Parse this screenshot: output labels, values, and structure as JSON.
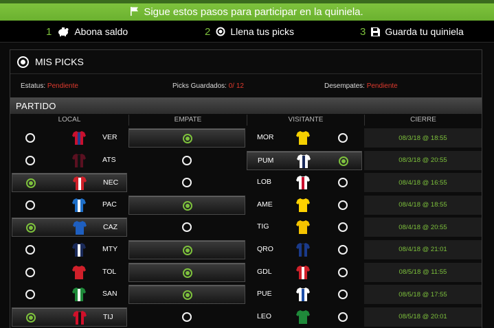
{
  "banner": {
    "text": "Sigue estos pasos para participar en la quiniela."
  },
  "steps": [
    {
      "num": "1",
      "label": "Abona saldo",
      "icon": "piggy-bank-icon"
    },
    {
      "num": "2",
      "label": "Llena tus picks",
      "icon": "radio-target-icon"
    },
    {
      "num": "3",
      "label": "Guarda tu quiniela",
      "icon": "floppy-disk-icon"
    }
  ],
  "panel": {
    "title": "MIS PICKS",
    "estatus_label": "Estatus:",
    "estatus_value": "Pendiente",
    "guardados_label": "Picks Guardados:",
    "guardados_value": "0/ 12",
    "desempates_label": "Desempates:",
    "desempates_value": "Pendiente",
    "partido": "PARTIDO"
  },
  "columns": {
    "local": "LOCAL",
    "empate": "EMPATE",
    "visitante": "VISITANTE",
    "cierre": "CIERRE"
  },
  "colors": {
    "accent": "#7dc13c",
    "pending": "#e03a2e"
  },
  "matches": [
    {
      "local": "VER",
      "local_colors": [
        "#c8102e",
        "#1f3f8f"
      ],
      "visitante": "MOR",
      "vis_colors": [
        "#f5d000",
        "#f5d000"
      ],
      "pick": "empate",
      "cierre": "08/3/18 @ 18:55"
    },
    {
      "local": "ATS",
      "local_colors": [
        "#5a1020",
        "#111111"
      ],
      "visitante": "PUM",
      "vis_colors": [
        "#ffffff",
        "#1a2a5a"
      ],
      "pick": "visitante",
      "cierre": "08/3/18 @ 20:55"
    },
    {
      "local": "NEC",
      "local_colors": [
        "#d0202a",
        "#ffffff"
      ],
      "visitante": "LOB",
      "vis_colors": [
        "#ffffff",
        "#c8102e"
      ],
      "pick": "local",
      "cierre": "08/4/18 @ 16:55"
    },
    {
      "local": "PAC",
      "local_colors": [
        "#1e6fc8",
        "#ffffff"
      ],
      "visitante": "AME",
      "vis_colors": [
        "#ffd200",
        "#ffd200"
      ],
      "pick": "empate",
      "cierre": "08/4/18 @ 18:55"
    },
    {
      "local": "CAZ",
      "local_colors": [
        "#1e5fc0",
        "#1e5fc0"
      ],
      "visitante": "TIG",
      "vis_colors": [
        "#f5c400",
        "#f5c400"
      ],
      "pick": "local",
      "cierre": "08/4/18 @ 20:55"
    },
    {
      "local": "MTY",
      "local_colors": [
        "#1a2a5a",
        "#ffffff"
      ],
      "visitante": "QRO",
      "vis_colors": [
        "#1a3a8a",
        "#111111"
      ],
      "pick": "empate",
      "cierre": "08/4/18 @ 21:01"
    },
    {
      "local": "TOL",
      "local_colors": [
        "#d0202a",
        "#d0202a"
      ],
      "visitante": "GDL",
      "vis_colors": [
        "#d0202a",
        "#ffffff"
      ],
      "pick": "empate",
      "cierre": "08/5/18 @ 11:55"
    },
    {
      "local": "SAN",
      "local_colors": [
        "#1f8a3a",
        "#ffffff"
      ],
      "visitante": "PUE",
      "vis_colors": [
        "#ffffff",
        "#1e4fa8"
      ],
      "pick": "empate",
      "cierre": "08/5/18 @ 17:55"
    },
    {
      "local": "TIJ",
      "local_colors": [
        "#d0102a",
        "#111111"
      ],
      "visitante": "LEO",
      "vis_colors": [
        "#1f8a3a",
        "#1f8a3a"
      ],
      "pick": "local",
      "cierre": "08/5/18 @ 20:01"
    }
  ]
}
